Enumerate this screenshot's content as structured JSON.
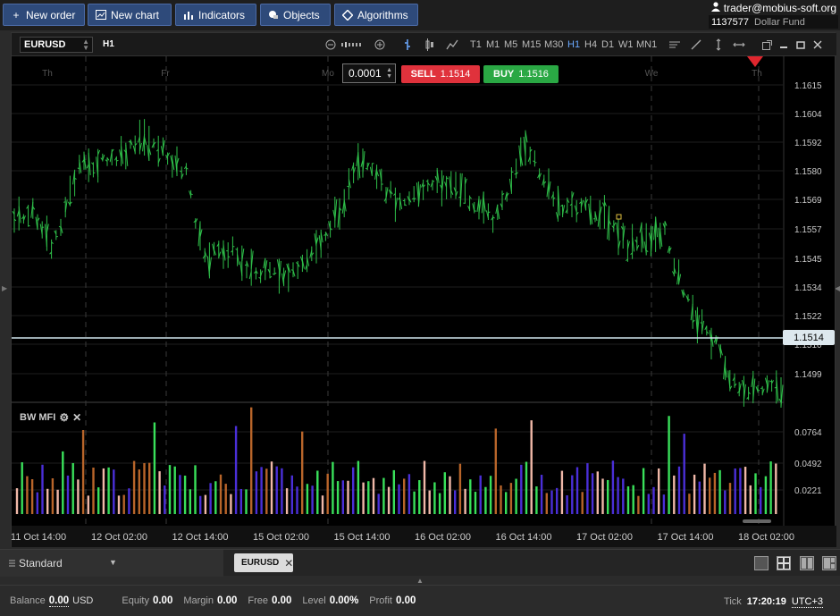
{
  "toolbar": {
    "new_order": "New order",
    "new_chart": "New chart",
    "indicators": "Indicators",
    "objects": "Objects",
    "algorithms": "Algorithms"
  },
  "account": {
    "user": "trader@mobius-soft.org",
    "id": "1137577",
    "fund": "Dollar Fund"
  },
  "chart": {
    "symbol": "EURUSD",
    "timeframe": "H1",
    "timeframes": [
      "T1",
      "M1",
      "M5",
      "M15",
      "M30",
      "H1",
      "H4",
      "D1",
      "W1",
      "MN1"
    ],
    "active_timeframe": "H1",
    "day_labels": [
      "Th",
      "Fr",
      "Mo",
      "We",
      "Th"
    ],
    "spread": "0.0001",
    "sell_label": "SELL",
    "sell_price": "1.1514",
    "buy_label": "BUY",
    "buy_price": "1.1516",
    "current_price": "1.1514",
    "price_ticks": [
      "1.1615",
      "1.1604",
      "1.1592",
      "1.1580",
      "1.1569",
      "1.1557",
      "1.1545",
      "1.1534",
      "1.1522",
      "1.1510",
      "1.1499"
    ],
    "indicator_name": "BW MFI",
    "indicator_ticks": [
      "0.0764",
      "0.0492",
      "0.0221"
    ],
    "time_labels": [
      "11 Oct 14:00",
      "12 Oct 02:00",
      "12 Oct 14:00",
      "15 Oct 02:00",
      "15 Oct 14:00",
      "16 Oct 02:00",
      "16 Oct 14:00",
      "17 Oct 02:00",
      "17 Oct 14:00",
      "18 Oct 02:00"
    ],
    "colors": {
      "up": "#2fbf4a",
      "mfi_green": "#39e05a",
      "mfi_blue": "#4a2fd8",
      "mfi_brown": "#b8652a",
      "mfi_pink": "#f0b8a8",
      "price_line": "#cfe6ee"
    }
  },
  "bottom": {
    "layout": "Standard",
    "tab_symbol": "EURUSD"
  },
  "status": {
    "balance_label": "Balance",
    "balance": "0.00",
    "currency": "USD",
    "equity_label": "Equity",
    "equity": "0.00",
    "margin_label": "Margin",
    "margin": "0.00",
    "free_label": "Free",
    "free": "0.00",
    "level_label": "Level",
    "level": "0.00%",
    "profit_label": "Profit",
    "profit": "0.00",
    "tick_label": "Tick",
    "tick_time": "17:20:19",
    "timezone": "UTC+3"
  }
}
